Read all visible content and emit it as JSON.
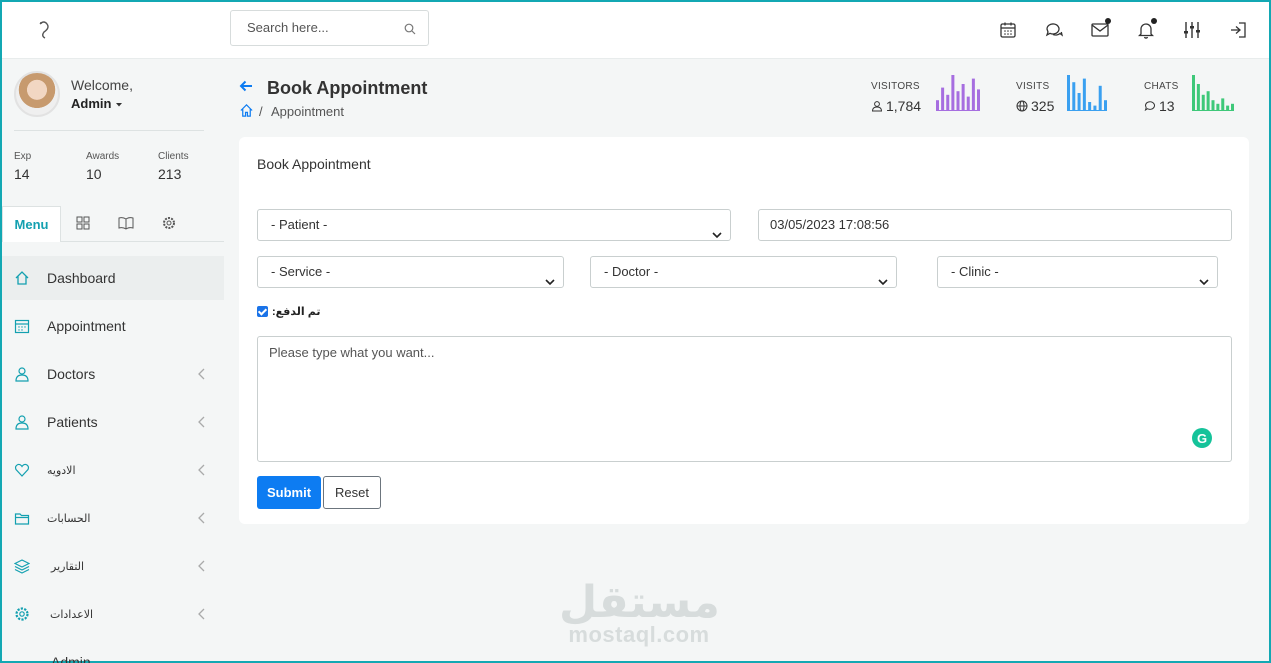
{
  "search": {
    "placeholder": "Search here..."
  },
  "header_icons": [
    "calendar-icon",
    "chat-icon",
    "mail-icon",
    "bell-icon",
    "sliders-icon",
    "logout-icon"
  ],
  "user": {
    "welcome": "Welcome,",
    "name": "Admin"
  },
  "stats": [
    {
      "label": "Exp",
      "value": "14"
    },
    {
      "label": "Awards",
      "value": "10"
    },
    {
      "label": "Clients",
      "value": "213"
    }
  ],
  "tabs": {
    "menu": "Menu"
  },
  "nav": [
    {
      "label": "Dashboard",
      "icon": "home-icon"
    },
    {
      "label": "Appointment",
      "icon": "calendar-icon"
    },
    {
      "label": "Doctors",
      "icon": "user-icon"
    },
    {
      "label": "Patients",
      "icon": "user-icon"
    },
    {
      "label": "الادويه",
      "icon": "heart-icon"
    },
    {
      "label": "الحسابات",
      "icon": "folder-icon"
    },
    {
      "label": "التقارير",
      "icon": "layers-icon"
    },
    {
      "label": "الاعدادات",
      "icon": "gear-icon"
    },
    {
      "label": "Admin",
      "icon": "user-icon"
    }
  ],
  "page": {
    "title": "Book Appointment",
    "breadcrumb": "Appointment"
  },
  "kpis": [
    {
      "label": "VISITORS",
      "value": "1,784",
      "color": "#a66ee0",
      "bars": [
        0.3,
        0.65,
        0.45,
        1.0,
        0.55,
        0.75,
        0.4,
        0.9,
        0.6
      ]
    },
    {
      "label": "VISITS",
      "value": "325",
      "color": "#3aa0f0",
      "bars": [
        1.0,
        0.8,
        0.5,
        0.9,
        0.25,
        0.15,
        0.7,
        0.3
      ]
    },
    {
      "label": "CHATS",
      "value": "13",
      "color": "#3ec879",
      "bars": [
        1.0,
        0.75,
        0.45,
        0.55,
        0.3,
        0.2,
        0.35,
        0.15,
        0.2
      ]
    }
  ],
  "form": {
    "card_title": "Book Appointment",
    "patient": "- Patient -",
    "datetime": "03/05/2023 17:08:56",
    "service": "- Service -",
    "doctor": "- Doctor -",
    "clinic": "- Clinic -",
    "paid_label": ":تم الدفع",
    "paid_checked": true,
    "notes_placeholder": "Please type what you want...",
    "submit": "Submit",
    "reset": "Reset"
  },
  "watermark": {
    "arabic": "مستقل",
    "latin": "mostaql.com"
  }
}
